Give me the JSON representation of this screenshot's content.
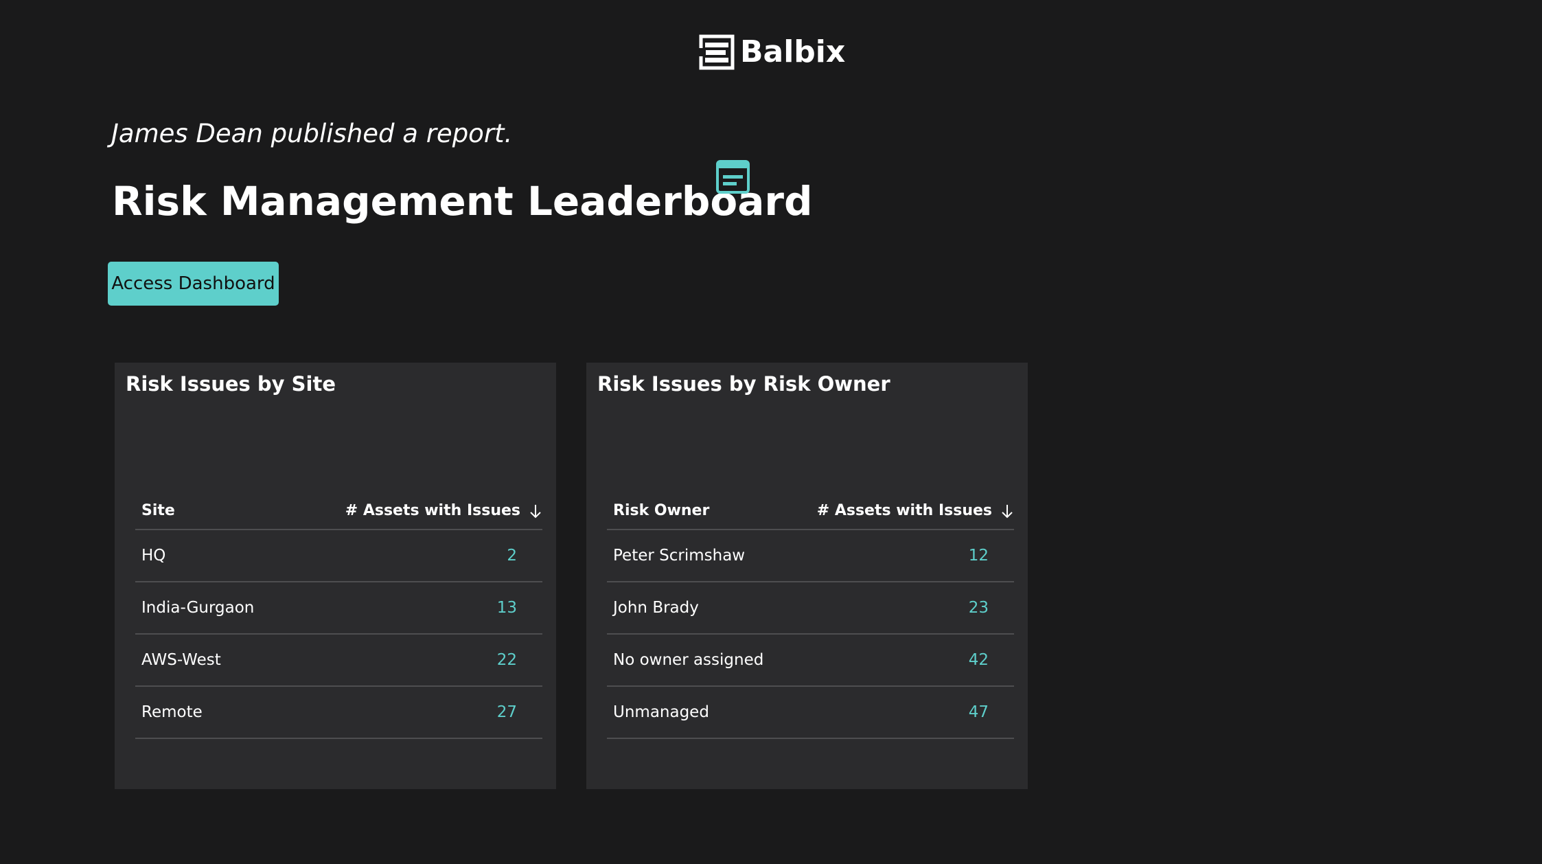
{
  "brand": {
    "name": "Balbix"
  },
  "header": {
    "published": "James Dean published a report.",
    "title": "Risk Management Leaderboard"
  },
  "actions": {
    "access_dashboard": "Access Dashboard"
  },
  "colors": {
    "accent": "#5ecfcb",
    "background": "#1a1a1b",
    "panel": "#2b2b2d",
    "divider": "#4e4e50"
  },
  "icons": {
    "logo": "balbix-logo-icon",
    "report": "report-icon",
    "sort": "arrow-down-icon"
  },
  "panels": [
    {
      "title": "Risk Issues by Site",
      "columns": [
        "Site",
        "# Assets with Issues"
      ],
      "rows": [
        {
          "name": "HQ",
          "value": "2"
        },
        {
          "name": "India-Gurgaon",
          "value": "13"
        },
        {
          "name": "AWS-West",
          "value": "22"
        },
        {
          "name": "Remote",
          "value": "27"
        }
      ]
    },
    {
      "title": "Risk Issues by Risk Owner",
      "columns": [
        "Risk Owner",
        "# Assets with Issues"
      ],
      "rows": [
        {
          "name": "Peter Scrimshaw",
          "value": "12"
        },
        {
          "name": "John Brady",
          "value": "23"
        },
        {
          "name": "No owner assigned",
          "value": "42"
        },
        {
          "name": "Unmanaged",
          "value": "47"
        }
      ]
    }
  ]
}
